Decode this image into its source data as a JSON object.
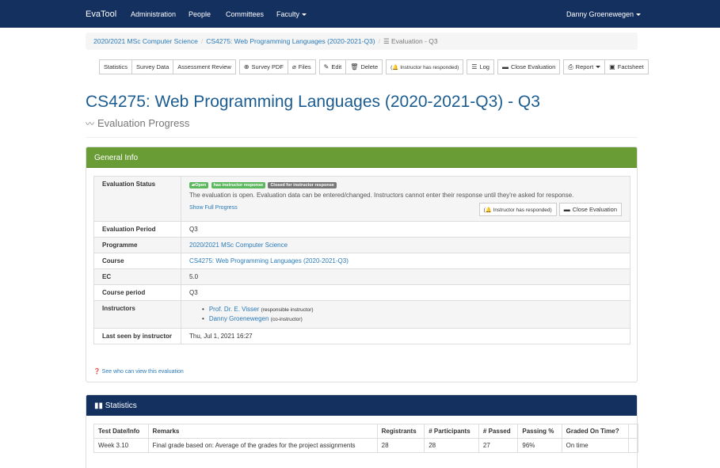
{
  "navbar": {
    "brand": "EvaTool",
    "items": [
      "Administration",
      "People",
      "Committees",
      "Faculty"
    ],
    "user": "Danny Groenewegen"
  },
  "breadcrumb": {
    "items": [
      "2020/2021 MSc Computer Science",
      "CS4275: Web Programming Languages (2020-2021-Q3)"
    ],
    "active_icon": "☰",
    "active": "Evaluation - Q3"
  },
  "toolbar": {
    "statistics": "Statistics",
    "survey_data": "Survey Data",
    "assessment_review": "Assessment Review",
    "survey_pdf": "Survey PDF",
    "files": "Files",
    "edit": "Edit",
    "delete": "Delete",
    "instructor_responded": "(🔔 Instructor has responded)",
    "log": "Log",
    "close_evaluation": "Close Evaluation",
    "report": "Report",
    "factsheet": "Factsheet"
  },
  "title": "CS4275: Web Programming Languages (2020-2021-Q3) - Q3",
  "subtitle": "Evaluation Progress",
  "general_info": {
    "heading": "General Info",
    "status_label": "Evaluation Status",
    "badges": [
      "Open",
      "has instructor response",
      "Closed for instructor response"
    ],
    "status_text": "The evaluation is open. Evaluation data can be entered/changed. Instructors cannot enter their response until they're asked for response.",
    "show_full_progress": "Show Full Progress",
    "instructor_responded_btn": "(🔔 Instructor has responded)",
    "close_evaluation_btn": "Close Evaluation",
    "rows": [
      {
        "label": "Evaluation Period",
        "value": "Q3"
      },
      {
        "label": "Programme",
        "value": "2020/2021 MSc Computer Science"
      },
      {
        "label": "Course",
        "value": "CS4275: Web Programming Languages (2020-2021-Q3)"
      },
      {
        "label": "EC",
        "value": "5.0"
      },
      {
        "label": "Course period",
        "value": "Q3"
      }
    ],
    "instructors_label": "Instructors",
    "instructors": [
      {
        "name": "Prof. Dr. E. Visser",
        "role": "(responsible instructor)"
      },
      {
        "name": "Danny Groenewegen",
        "role": "(co-instructor)"
      }
    ],
    "last_seen_label": "Last seen by instructor",
    "last_seen": "Thu, Jul 1, 2021 16:27",
    "see_who": "See who can view this evaluation"
  },
  "statistics": {
    "heading": "Statistics",
    "columns": [
      "Test Date/Info",
      "Remarks",
      "Registrants",
      "# Participants",
      "# Passed",
      "Passing %",
      "Graded On Time?"
    ],
    "rows": [
      [
        "Week 3.10",
        "Final grade based on: Average of the grades for the project assignments",
        "28",
        "28",
        "27",
        "96%",
        "On time"
      ]
    ]
  }
}
